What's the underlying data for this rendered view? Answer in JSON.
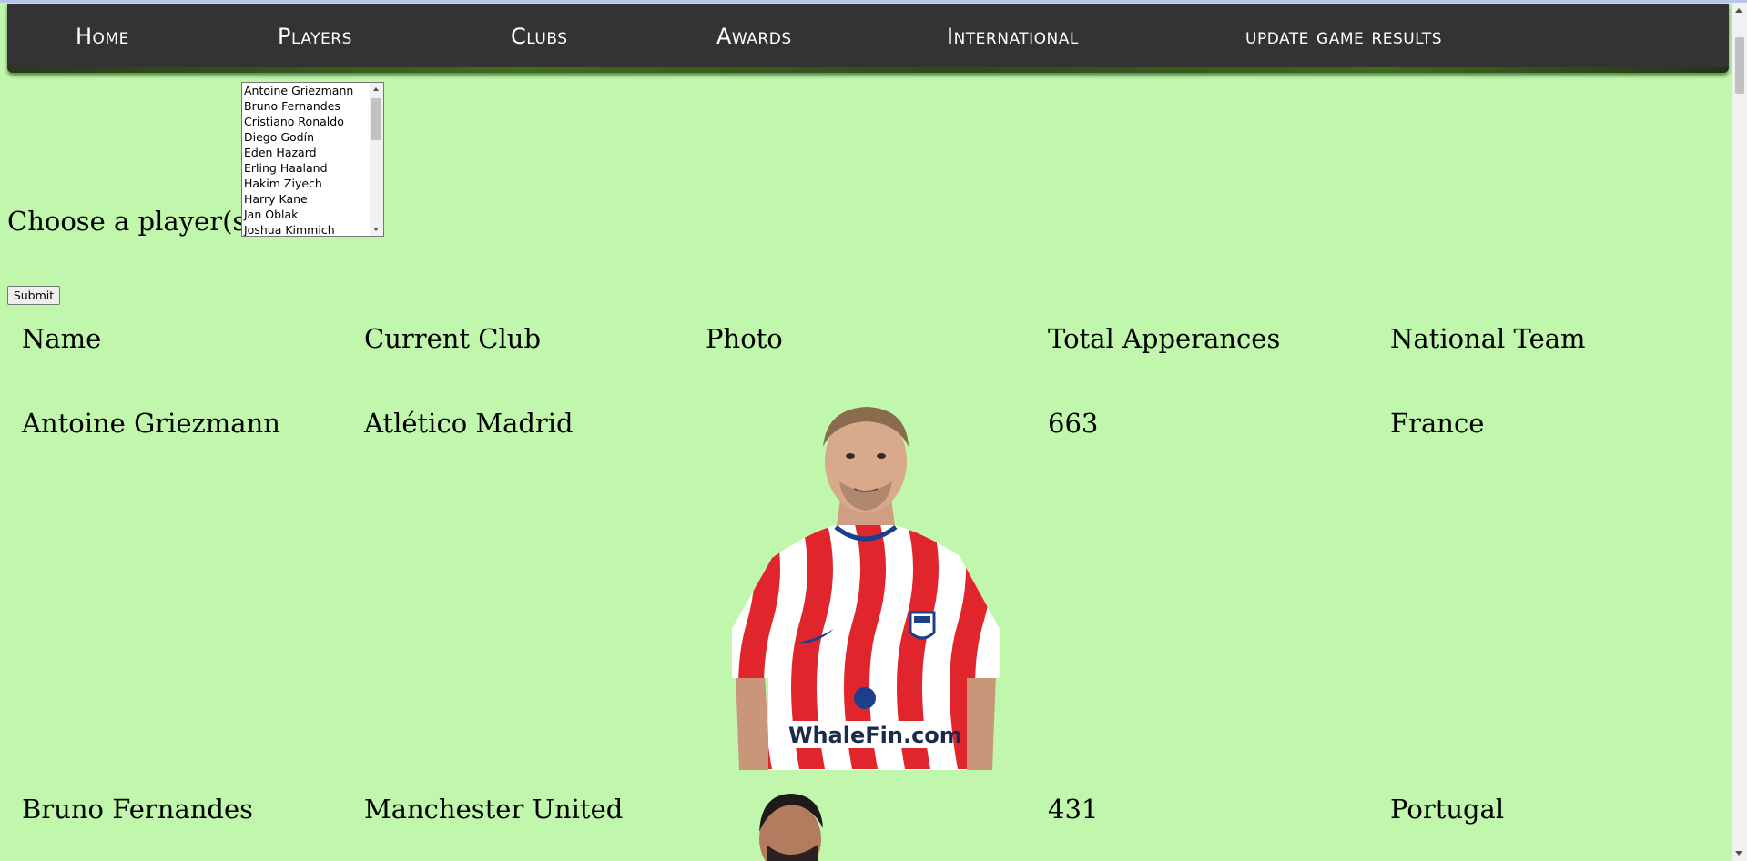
{
  "nav": {
    "items": [
      {
        "label": "Home"
      },
      {
        "label": "Players"
      },
      {
        "label": "Clubs"
      },
      {
        "label": "Awards"
      },
      {
        "label": "International"
      },
      {
        "label": "update game results"
      }
    ]
  },
  "form": {
    "choose_label": "Choose a player(s):",
    "options": [
      "Antoine Griezmann",
      "Bruno Fernandes",
      "Cristiano Ronaldo",
      "Diego Godín",
      "Eden Hazard",
      "Erling Haaland",
      "Hakim Ziyech",
      "Harry Kane",
      "Jan Oblak",
      "Joshua Kimmich"
    ],
    "submit_label": "Submit"
  },
  "table": {
    "headers": [
      "Name",
      "Current Club",
      "Photo",
      "Total Apperances",
      "National Team"
    ],
    "rows": [
      {
        "name": "Antoine Griezmann",
        "club": "Atlético Madrid",
        "appearances": "663",
        "national_team": "France",
        "shirt_sponsor": "WhaleFin.com"
      },
      {
        "name": "Bruno Fernandes",
        "club": "Manchester United",
        "appearances": "431",
        "national_team": "Portugal"
      }
    ]
  },
  "colors": {
    "page_background": "#c0f7ac",
    "navbar_background": "#333333",
    "nav_text": "#ffffff"
  }
}
